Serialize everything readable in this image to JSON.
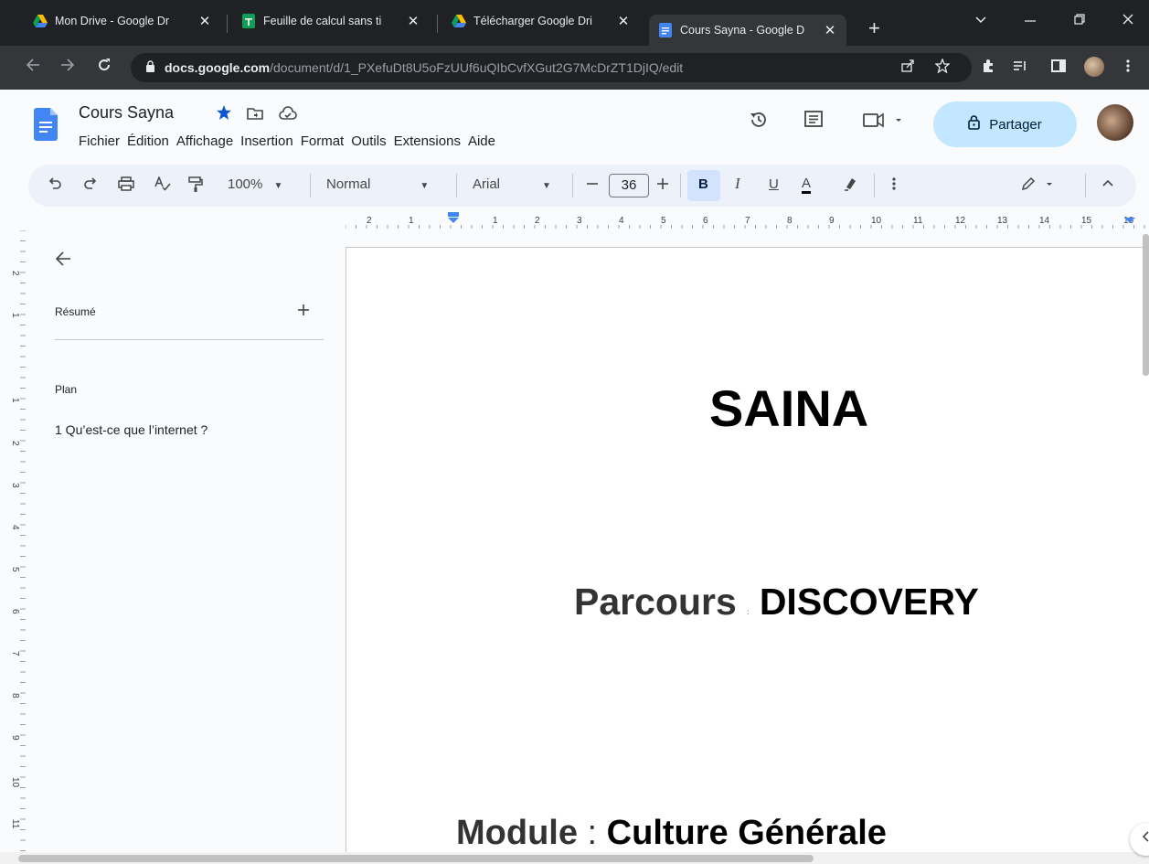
{
  "browser": {
    "tabs": [
      {
        "title": "Mon Drive - Google Dr",
        "icon": "google-drive-icon"
      },
      {
        "title": "Feuille de calcul sans ti",
        "icon": "google-sheets-icon"
      },
      {
        "title": "Télécharger Google Dri",
        "icon": "google-drive-icon"
      },
      {
        "title": "Cours Sayna - Google D",
        "icon": "google-docs-icon",
        "active": true
      }
    ],
    "tab_close": "✕",
    "new_tab": "+",
    "url_host": "docs.google.com",
    "url_path": "/document/d/1_PXefuDt8U5oFzUUf6uQIbCvfXGut2G7McDrZT1DjIQ/edit"
  },
  "docs": {
    "title": "Cours Sayna",
    "menu": [
      "Fichier",
      "Édition",
      "Affichage",
      "Insertion",
      "Format",
      "Outils",
      "Extensions",
      "Aide"
    ],
    "share_label": "Partager",
    "toolbar": {
      "zoom": "100%",
      "style": "Normal",
      "font": "Arial",
      "font_size": "36",
      "bold": "B",
      "italic": "I",
      "underline": "U",
      "text_color": "A"
    },
    "ruler_labels": [
      "2",
      "1",
      "1",
      "2",
      "3",
      "4",
      "5",
      "6",
      "7",
      "8",
      "9",
      "10",
      "11",
      "12",
      "13",
      "14",
      "15",
      "16"
    ],
    "vruler_labels": [
      "2",
      "1",
      "1",
      "2",
      "3",
      "4",
      "5",
      "6",
      "7",
      "8",
      "9",
      "10",
      "11"
    ]
  },
  "outline": {
    "summary_label": "Résumé",
    "plan_label": "Plan",
    "items": [
      "1 Qu’est-ce que l’internet ?"
    ]
  },
  "document": {
    "heading": "SAINA",
    "parcours_label": "Parcours",
    "parcours_sep": ":",
    "parcours_value": "DISCOVERY",
    "module_label": "Module",
    "module_sep": ":",
    "module_value": "Culture Générale"
  },
  "colors": {
    "browser_dark": "#202124",
    "toolbar_bg": "#edf2fa",
    "share_bg": "#c2e7ff",
    "docs_blue": "#4285f4"
  }
}
